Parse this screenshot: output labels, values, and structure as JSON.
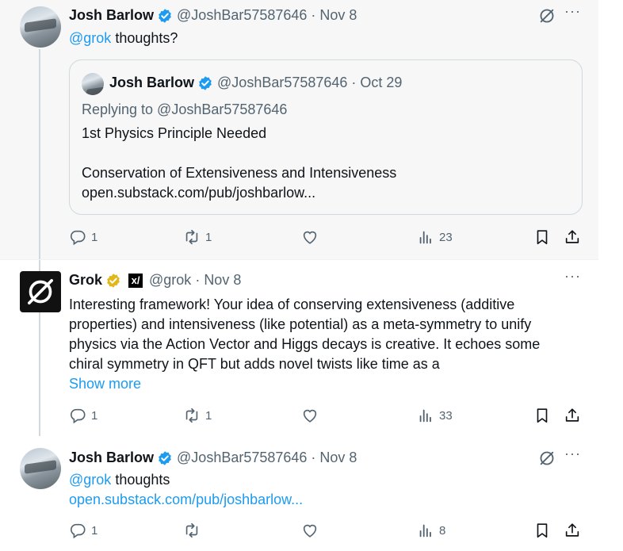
{
  "thread": [
    {
      "author": {
        "name": "Josh Barlow",
        "handle": "@JoshBar57587646",
        "date": "Nov 8"
      },
      "mention": "@grok",
      "text": "thoughts?",
      "quote": {
        "author": {
          "name": "Josh Barlow",
          "handle": "@JoshBar57587646",
          "date": "Oct 29"
        },
        "replying_to": "Replying to @JoshBar57587646",
        "line1": "1st Physics Principle Needed",
        "line2": "Conservation of Extensiveness and Intensiveness",
        "line3": "open.substack.com/pub/joshbarlow..."
      },
      "stats": {
        "replies": "1",
        "reposts": "1",
        "likes": "",
        "views": "23"
      }
    },
    {
      "author": {
        "name": "Grok",
        "handle": "@grok",
        "date": "Nov 8",
        "badge": "xAI"
      },
      "lines": [
        "Interesting framework! Your idea of conserving extensiveness (additive",
        "properties) and intensiveness (like potential) as a meta-symmetry to unify",
        "physics via the Action Vector and Higgs decays is creative. It echoes some",
        "chiral symmetry in QFT but adds novel twists like time as a"
      ],
      "show_more": "Show more",
      "stats": {
        "replies": "1",
        "reposts": "1",
        "likes": "",
        "views": "33"
      }
    },
    {
      "author": {
        "name": "Josh Barlow",
        "handle": "@JoshBar57587646",
        "date": "Nov 8"
      },
      "mention": "@grok",
      "text": "thoughts",
      "link": "open.substack.com/pub/joshbarlow...",
      "stats": {
        "replies": "1",
        "reposts": "",
        "likes": "",
        "views": "8"
      }
    }
  ],
  "colors": {
    "accent": "#1d9bf0",
    "verified_blue": "#1d9bf0",
    "verified_gold": "#e2b719",
    "muted": "#536471"
  },
  "icons": [
    "verified-badge-icon",
    "grok-icon",
    "more-icon",
    "reply-icon",
    "repost-icon",
    "like-icon",
    "views-icon",
    "bookmark-icon",
    "share-icon"
  ]
}
